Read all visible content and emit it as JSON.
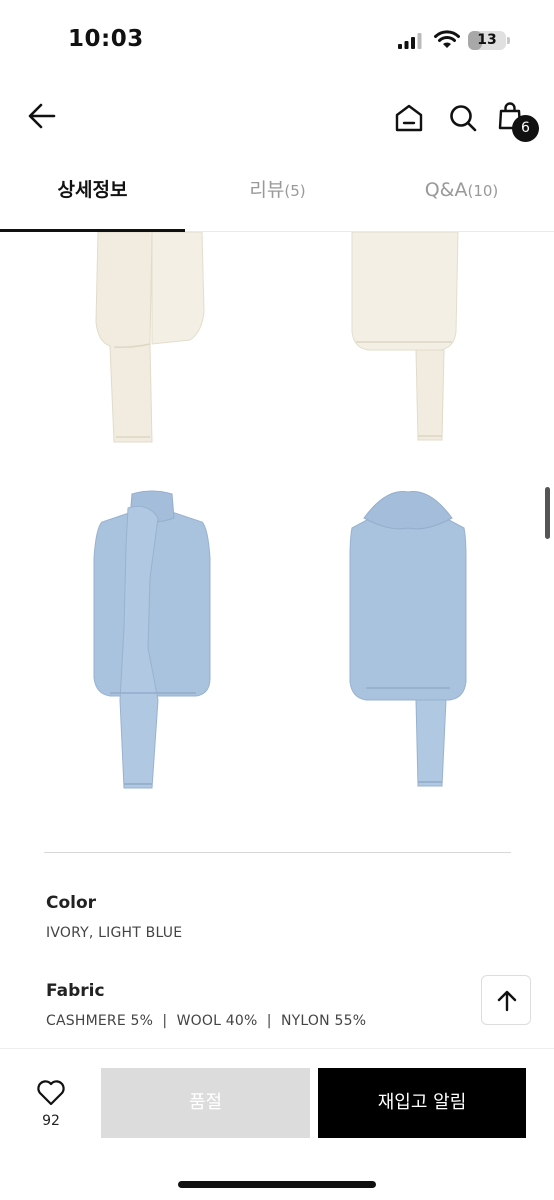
{
  "status_bar": {
    "time": "10:03",
    "battery": "13",
    "icons": [
      "signal-icon",
      "wifi-icon",
      "battery-icon"
    ]
  },
  "header": {
    "icons": [
      "back-arrow-icon",
      "home-icon",
      "search-icon",
      "shopping-bag-icon"
    ],
    "cart_count": "6"
  },
  "tabs": [
    {
      "label": "상세정보",
      "count": ""
    },
    {
      "label": "리뷰",
      "count": "(5)"
    },
    {
      "label": "Q&A",
      "count": "(10)"
    }
  ],
  "colors": {
    "ivory": "#f3efe4",
    "light_blue": "#a9c2dd",
    "soldout_bg": "#dcdcdc",
    "primary_btn": "#000000"
  },
  "specs": {
    "color_label": "Color",
    "color_value": "IVORY, LIGHT BLUE",
    "fabric_label": "Fabric",
    "fabric_value": "CASHMERE 5%  |  WOOL 40%  |  NYLON 55%"
  },
  "bottom_bar": {
    "like_count": "92",
    "soldout_label": "품절",
    "restock_label": "재입고 알림"
  }
}
